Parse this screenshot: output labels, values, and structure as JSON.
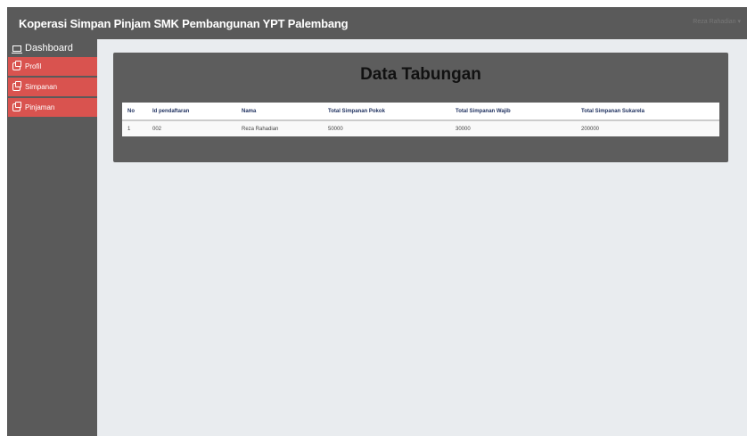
{
  "header": {
    "brand": "Koperasi Simpan Pinjam SMK Pembangunan YPT Palembang",
    "user_menu": "Reza Rahadian ▾"
  },
  "sidebar": {
    "items": [
      {
        "label": "Dashboard",
        "icon": "laptop-icon"
      },
      {
        "label": "Profil",
        "icon": "copy-icon"
      },
      {
        "label": "Simpanan",
        "icon": "copy-icon"
      },
      {
        "label": "Pinjaman",
        "icon": "copy-icon"
      }
    ]
  },
  "main": {
    "title": "Data Tabungan",
    "table": {
      "headers": [
        "No",
        "Id pendaftaran",
        "Nama",
        "Total Simpanan Pokok",
        "Total Simpanan Wajib",
        "Total Simpanan Sukarela"
      ],
      "rows": [
        [
          "1",
          "002",
          "Reza Rahadian",
          "50000",
          "30000",
          "200000"
        ]
      ]
    }
  },
  "colors": {
    "topbar": "#5a5a5a",
    "sidebar": "#5a5a5a",
    "nav_active": "#d9534f",
    "panel": "#5d5d5d",
    "content_bg": "#e9ecef"
  }
}
